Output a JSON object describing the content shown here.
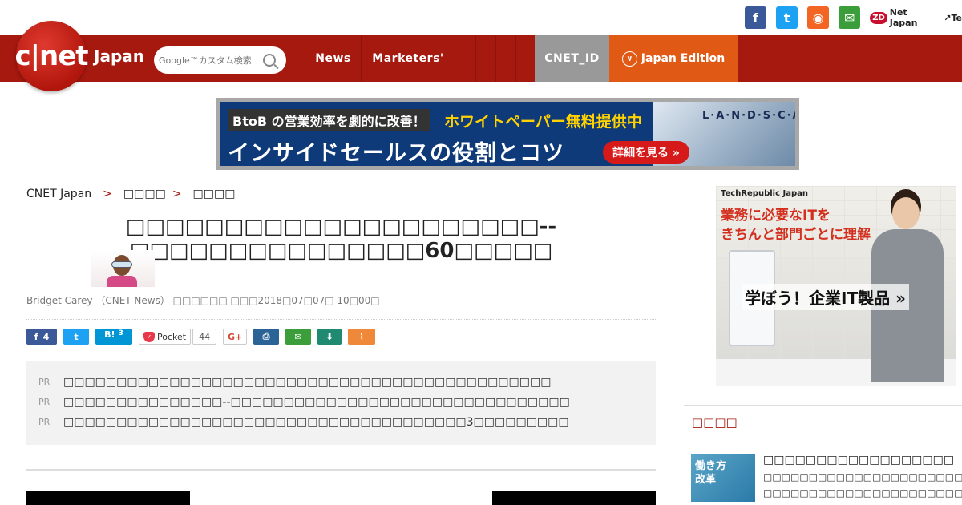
{
  "top_social": {
    "facebook": "f",
    "twitter": "t",
    "rss": "◉",
    "mail": "✉",
    "zdnet": "Net Japan",
    "zdnet_badge": "ZD",
    "techrepublic": "Te"
  },
  "header": {
    "logo": "c|net",
    "logo_sub": "Japan",
    "search_placeholder": "Google™カスタム検索",
    "nav": [
      "News",
      "Marketers'",
      "",
      "",
      "",
      ""
    ],
    "cnet_id": "CNET_ID",
    "edition": "Japan Edition"
  },
  "banner": {
    "tag": "BtoB の営業効率を劇的に改善！",
    "highlight": "ホワイトペーパー無料提供中",
    "headline": "インサイドセールスの役割とコツ",
    "cta": "詳細を見る »",
    "brand": "L·A·N·D·S·C·A·P·E"
  },
  "breadcrumb": {
    "home": "CNET Japan",
    "sep": ">",
    "level1": "□□□□",
    "level2": "□□□□"
  },
  "article": {
    "title": "□□□□□□□□□□□□□□□□□□□□□--□□□□□□□□□□□□□□□60□□□□□",
    "byline": "Bridget Carey （CNET News） □□□□□□ □□□2018□07□07□ 10□00□"
  },
  "share": {
    "facebook_count": "4",
    "hatena": "B!",
    "hatena_count": "3",
    "pocket": "Pocket",
    "pocket_count": "44",
    "gplus": "G+",
    "print": "⎙",
    "mail": "✉",
    "save": "⬇",
    "clip": "⌇"
  },
  "pr": {
    "tag": "PR",
    "items": [
      "□□□□□□□□□□□□□□□□□□□□□□□□□□□□□□□□□□□□□□□□□□□□□□",
      "□□□□□□□□□□□□□□□--□□□□□□□□□□□□□□□□□□□□□□□□□□□□□□□□",
      "□□□□□□□□□□□□□□□□□□□□□□□□□□□□□□□□□□□□□□3□□□□□□□□□"
    ]
  },
  "side_ad": {
    "brand": "TechRepublic Japan",
    "line1": "業務に必要なITを",
    "line2": "きちんと部門ごとに理解",
    "cta": "学ぼう！企業IT製品 »"
  },
  "sidebar": {
    "section_title": "□□□□",
    "item_img_text": "働き方\n改革",
    "item_title": "□□□□□□□□□□□□□□□□□□",
    "item_line1": "□□□□□□□□□□□□□□□□□□□□□□",
    "item_line2": "□□□□□□□□□□□□□□□□□□□□□□"
  }
}
